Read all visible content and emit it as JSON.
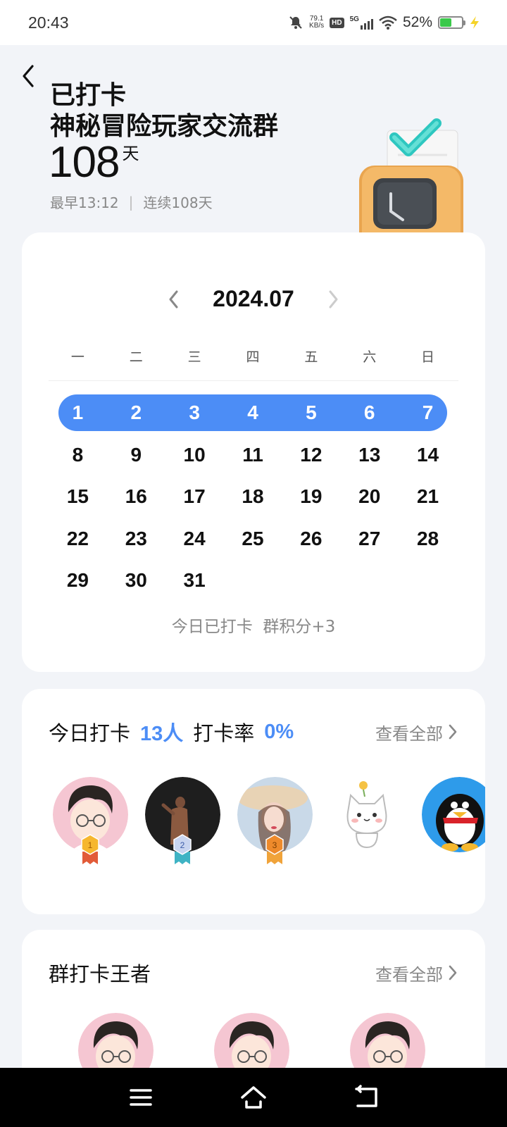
{
  "status_bar": {
    "time": "20:43",
    "net_speed_value": "79.1",
    "net_speed_unit": "KB/s",
    "hd_label": "HD",
    "network_label": "5G",
    "battery_text": "52%",
    "battery_level": 0.52
  },
  "header": {
    "title_line1": "已打卡",
    "title_line2": "神秘冒险玩家交流群",
    "streak_days": "108",
    "streak_unit": "天",
    "earliest": "最早13:12",
    "separator": "|",
    "continuous": "连续108天"
  },
  "calendar": {
    "month_label": "2024.07",
    "weekdays": [
      "一",
      "二",
      "三",
      "四",
      "五",
      "六",
      "日"
    ],
    "days": [
      "1",
      "2",
      "3",
      "4",
      "5",
      "6",
      "7",
      "8",
      "9",
      "10",
      "11",
      "12",
      "13",
      "14",
      "15",
      "16",
      "17",
      "18",
      "19",
      "20",
      "21",
      "22",
      "23",
      "24",
      "25",
      "26",
      "27",
      "28",
      "29",
      "30",
      "31"
    ],
    "checked_days": [
      "1",
      "2",
      "3",
      "4",
      "5",
      "6",
      "7"
    ],
    "today_note": "今日已打卡  群积分+3",
    "accent_color": "#4C8DF6"
  },
  "today_checkin": {
    "label_prefix": "今日打卡",
    "count": "13人",
    "rate_label": "打卡率",
    "rate_value": "0%",
    "view_all": "查看全部",
    "avatars": [
      {
        "icon": "cartoon-boy-avatar",
        "medal": "1"
      },
      {
        "icon": "dark-photo-avatar",
        "medal": "2"
      },
      {
        "icon": "girl-photo-avatar",
        "medal": "3"
      },
      {
        "icon": "cat-sticker-avatar"
      },
      {
        "icon": "penguin-avatar"
      }
    ]
  },
  "king": {
    "title": "群打卡王者",
    "view_all": "查看全部"
  }
}
